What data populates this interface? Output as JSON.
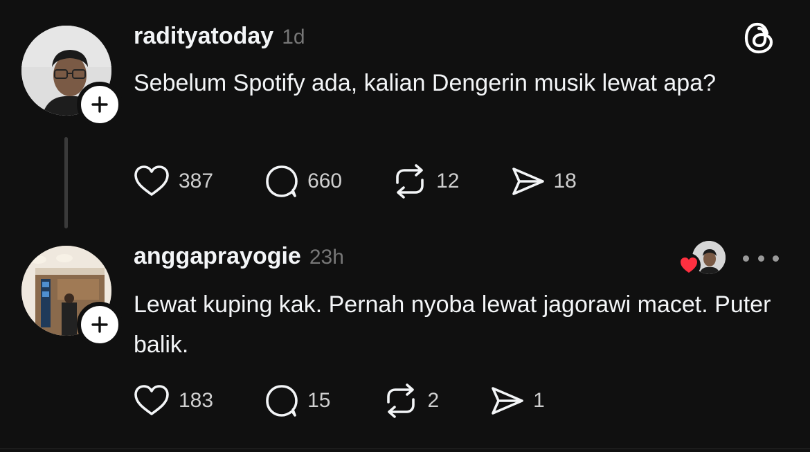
{
  "app": {
    "background": "#101010",
    "text_color": "#f3f5f7",
    "muted_color": "#777777",
    "heart_color": "#ff3040"
  },
  "posts": [
    {
      "username": "radityatoday",
      "timestamp": "1d",
      "text": "Sebelum Spotify ada, kalian Dengerin musik lewat apa?",
      "avatar_icon": "profile-photo",
      "follow_icon": "plus-icon",
      "top_right_icon": "threads-logo-icon",
      "actions": {
        "like_count": "387",
        "reply_count": "660",
        "repost_count": "12",
        "share_count": "18"
      }
    },
    {
      "username": "anggaprayogie",
      "timestamp": "23h",
      "text": "Lewat kuping kak. Pernah nyoba lewat jagorawi macet. Puter balik.",
      "avatar_icon": "profile-photo",
      "follow_icon": "plus-icon",
      "liked_by_author_icon": "heart-icon",
      "more_icon": "ellipsis-icon",
      "actions": {
        "like_count": "183",
        "reply_count": "15",
        "repost_count": "2",
        "share_count": "1"
      }
    }
  ]
}
